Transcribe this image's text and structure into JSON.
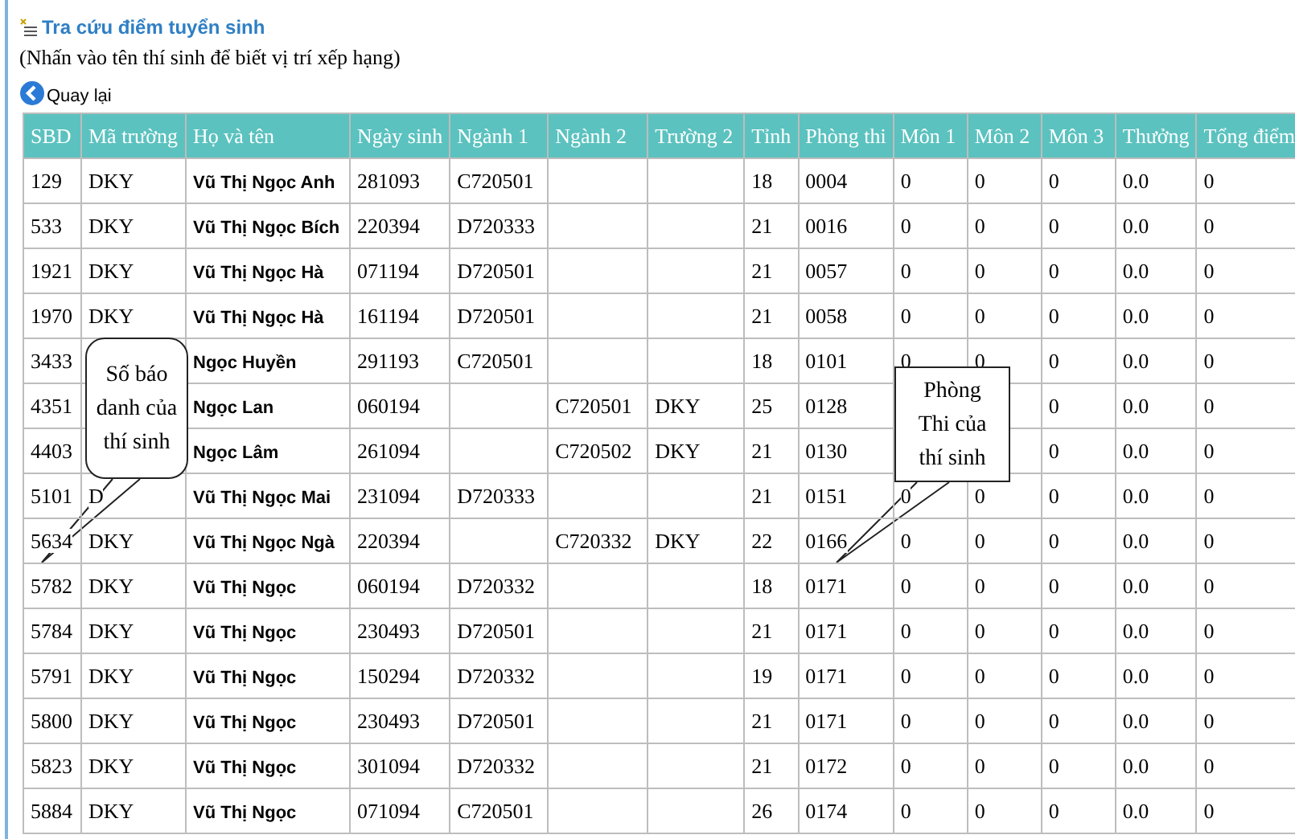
{
  "title": "Tra cứu điểm tuyển sinh",
  "hint": "(Nhấn vào tên thí sinh để biết vị trí xếp hạng)",
  "back_link": "Quay lại",
  "table": {
    "columns": [
      "SBD",
      "Mã trường",
      "Họ và tên",
      "Ngày sinh",
      "Ngành 1",
      "Ngành 2",
      "Trường 2",
      "Tỉnh",
      "Phòng thi",
      "Môn 1",
      "Môn 2",
      "Môn 3",
      "Thưởng",
      "Tổng điểm"
    ],
    "rows": [
      [
        "129",
        "DKY",
        "Vũ Thị Ngọc Anh",
        "281093",
        "C720501",
        null,
        null,
        "18",
        "0004",
        "0",
        "0",
        "0",
        "0.0",
        "0"
      ],
      [
        "533",
        "DKY",
        "Vũ Thị Ngọc Bích",
        "220394",
        "D720333",
        null,
        null,
        "21",
        "0016",
        "0",
        "0",
        "0",
        "0.0",
        "0"
      ],
      [
        "1921",
        "DKY",
        "Vũ Thị Ngọc Hà",
        "071194",
        "D720501",
        null,
        null,
        "21",
        "0057",
        "0",
        "0",
        "0",
        "0.0",
        "0"
      ],
      [
        "1970",
        "DKY",
        "Vũ Thị Ngọc Hà",
        "161194",
        "D720501",
        null,
        null,
        "21",
        "0058",
        "0",
        "0",
        "0",
        "0.0",
        "0"
      ],
      [
        "3433",
        null,
        "Ngọc Huyền",
        "291193",
        "C720501",
        null,
        null,
        "18",
        "0101",
        "0",
        "0",
        "0",
        "0.0",
        "0"
      ],
      [
        "4351",
        null,
        "Ngọc Lan",
        "060194",
        null,
        "C720501",
        "DKY",
        "25",
        "0128",
        null,
        null,
        "0",
        "0.0",
        "0"
      ],
      [
        "4403",
        null,
        "Ngọc Lâm",
        "261094",
        null,
        "C720502",
        "DKY",
        "21",
        "0130",
        null,
        null,
        "0",
        "0.0",
        "0"
      ],
      [
        "5101",
        "D",
        "Vũ Thị Ngọc Mai",
        "231094",
        "D720333",
        null,
        null,
        "21",
        "0151",
        "0",
        "0",
        "0",
        "0.0",
        "0"
      ],
      [
        "5634",
        "DKY",
        "Vũ Thị Ngọc Ngà",
        "220394",
        null,
        "C720332",
        "DKY",
        "22",
        "0166",
        "0",
        "0",
        "0",
        "0.0",
        "0"
      ],
      [
        "5782",
        "DKY",
        "Vũ Thị Ngọc",
        "060194",
        "D720332",
        null,
        null,
        "18",
        "0171",
        "0",
        "0",
        "0",
        "0.0",
        "0"
      ],
      [
        "5784",
        "DKY",
        "Vũ Thị Ngọc",
        "230493",
        "D720501",
        null,
        null,
        "21",
        "0171",
        "0",
        "0",
        "0",
        "0.0",
        "0"
      ],
      [
        "5791",
        "DKY",
        "Vũ Thị Ngọc",
        "150294",
        "D720332",
        null,
        null,
        "19",
        "0171",
        "0",
        "0",
        "0",
        "0.0",
        "0"
      ],
      [
        "5800",
        "DKY",
        "Vũ Thị Ngọc",
        "230493",
        "D720501",
        null,
        null,
        "21",
        "0171",
        "0",
        "0",
        "0",
        "0.0",
        "0"
      ],
      [
        "5823",
        "DKY",
        "Vũ Thị Ngọc",
        "301094",
        "D720332",
        null,
        null,
        "21",
        "0172",
        "0",
        "0",
        "0",
        "0.0",
        "0"
      ],
      [
        "5884",
        "DKY",
        "Vũ Thị Ngọc",
        "071094",
        "C720501",
        null,
        null,
        "26",
        "0174",
        "0",
        "0",
        "0",
        "0.0",
        "0"
      ]
    ]
  },
  "callouts": [
    {
      "kind": "rounded",
      "lines": [
        "Số báo",
        "danh của",
        "thí sinh"
      ]
    },
    {
      "kind": "rect",
      "lines": [
        "Phòng",
        "Thi của",
        "thí sinh"
      ]
    }
  ]
}
